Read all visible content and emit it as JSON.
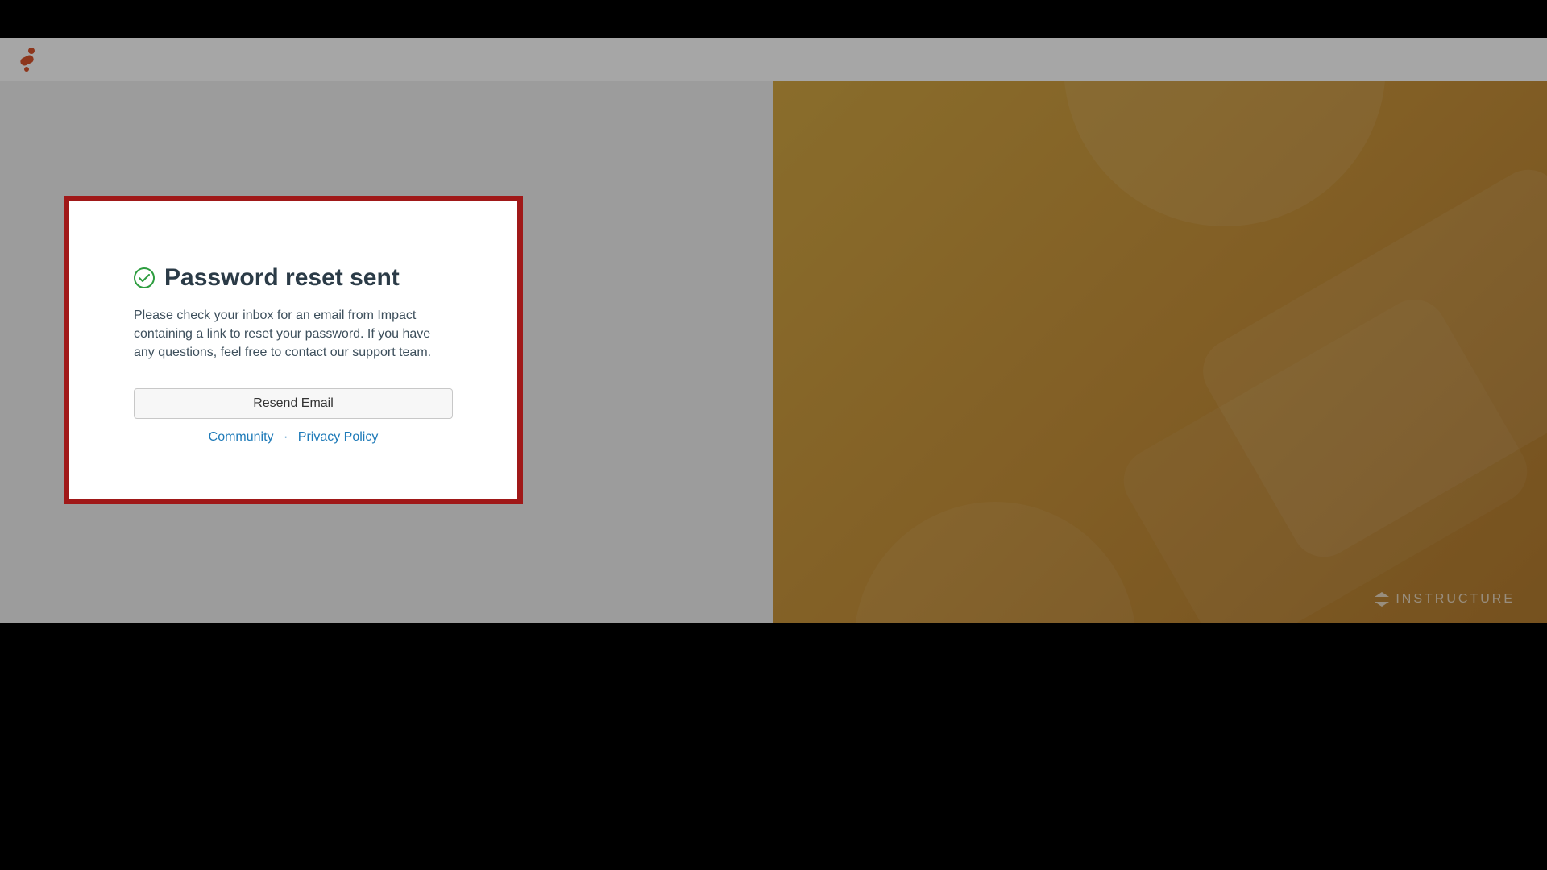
{
  "dialog": {
    "title": "Password reset sent",
    "body": "Please check your inbox for an email from Impact containing a link to reset your password. If you have any questions, feel free to contact our support team.",
    "resend_label": "Resend Email"
  },
  "links": {
    "community": "Community",
    "separator": "·",
    "privacy": "Privacy Policy"
  },
  "footer": {
    "brand": "INSTRUCTURE"
  }
}
